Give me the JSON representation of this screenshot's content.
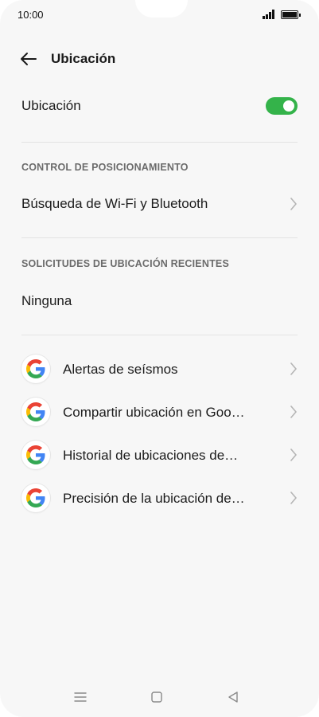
{
  "status": {
    "time": "10:00"
  },
  "header": {
    "title": "Ubicación",
    "back_icon": "back-arrow-icon"
  },
  "location_toggle": {
    "label": "Ubicación",
    "on": true,
    "color": "#34b34a"
  },
  "positioning": {
    "section_label": "CONTROL DE POSICIONAMIENTO",
    "item": "Búsqueda de Wi-Fi y Bluetooth"
  },
  "recent": {
    "section_label": "SOLICITUDES DE UBICACIÓN RECIENTES",
    "value": "Ninguna"
  },
  "google_items": [
    {
      "label": "Alertas de seísmos",
      "icon": "google-icon"
    },
    {
      "label": "Compartir ubicación en Goo…",
      "icon": "google-icon"
    },
    {
      "label": "Historial de ubicaciones de…",
      "icon": "google-icon"
    },
    {
      "label": "Precisión de la ubicación de…",
      "icon": "google-icon"
    }
  ],
  "navbar": {
    "menu_icon": "menu-icon",
    "home_icon": "home-icon",
    "back_icon": "back-triangle-icon"
  }
}
